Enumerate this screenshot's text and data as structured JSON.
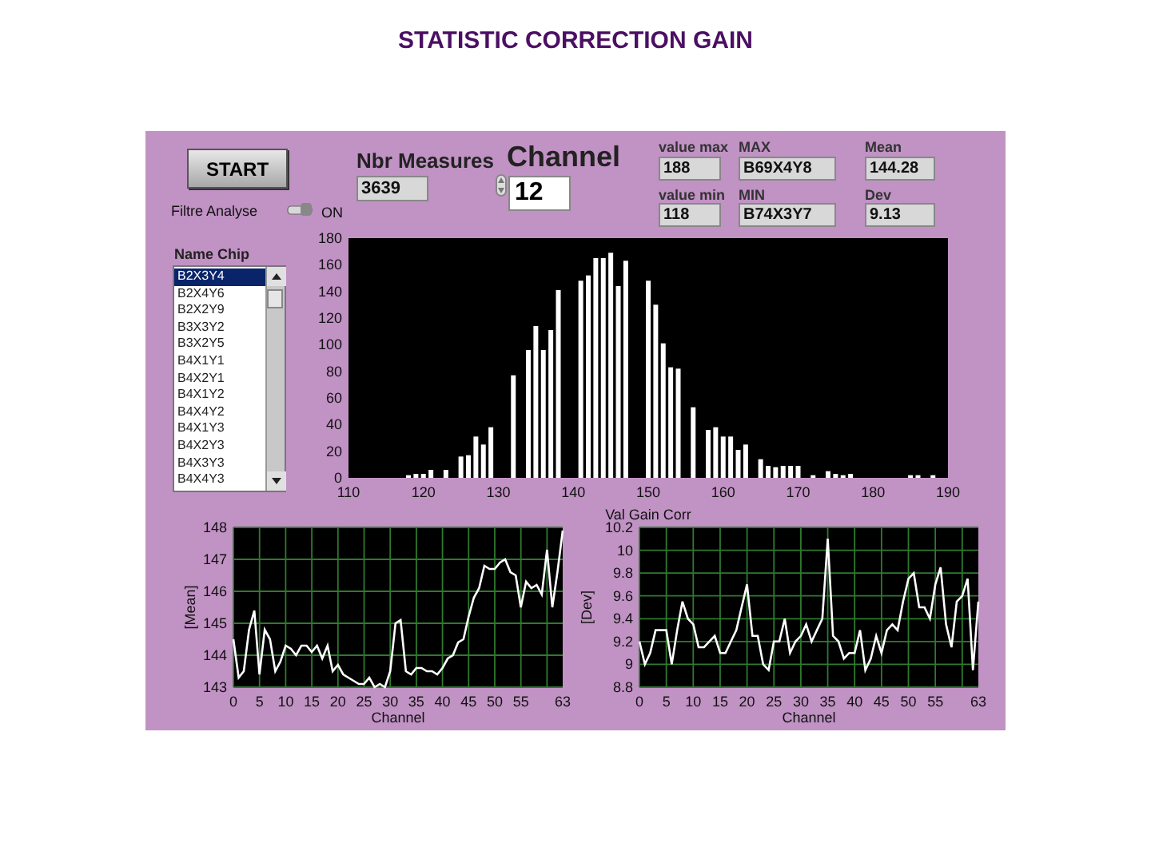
{
  "title": "STATISTIC CORRECTION GAIN",
  "start_button": {
    "label": "START"
  },
  "filter": {
    "label": "Filtre Analyse",
    "on": true,
    "state_label": "ON"
  },
  "nbr_measures": {
    "label": "Nbr Measures",
    "value": "3639"
  },
  "channel": {
    "label": "Channel",
    "value": "12"
  },
  "stats": [
    {
      "label": "value max",
      "value": "188"
    },
    {
      "label": "MAX",
      "value": "B69X4Y8"
    },
    {
      "label": "Mean",
      "value": "144.28"
    },
    {
      "label": "value min",
      "value": "118"
    },
    {
      "label": "MIN",
      "value": "B74X3Y7"
    },
    {
      "label": "Dev",
      "value": "9.13"
    }
  ],
  "name_chip": {
    "label": "Name Chip",
    "items": [
      {
        "text": "B2X3Y4",
        "selected": true
      },
      {
        "text": "B2X4Y6",
        "selected": false
      },
      {
        "text": "B2X2Y9",
        "selected": false
      },
      {
        "text": "B3X3Y2",
        "selected": false
      },
      {
        "text": "B3X2Y5",
        "selected": false
      },
      {
        "text": "B4X1Y1",
        "selected": false
      },
      {
        "text": "B4X2Y1",
        "selected": false
      },
      {
        "text": "B4X1Y2",
        "selected": false
      },
      {
        "text": "B4X4Y2",
        "selected": false
      },
      {
        "text": "B4X1Y3",
        "selected": false
      },
      {
        "text": "B4X2Y3",
        "selected": false
      },
      {
        "text": "B4X3Y3",
        "selected": false
      },
      {
        "text": "B4X4Y3",
        "selected": false
      }
    ]
  },
  "histogram": {
    "chart_data": {
      "type": "bar",
      "xlabel": "Val Gain Corr",
      "x": [
        118,
        119,
        120,
        121,
        123,
        125,
        126,
        127,
        128,
        129,
        132,
        134,
        135,
        136,
        137,
        138,
        141,
        142,
        143,
        144,
        145,
        146,
        147,
        150,
        151,
        152,
        153,
        154,
        156,
        158,
        159,
        160,
        161,
        162,
        163,
        165,
        166,
        167,
        168,
        169,
        170,
        172,
        174,
        175,
        176,
        177,
        185,
        186,
        188
      ],
      "values": [
        2,
        3,
        3,
        6,
        6,
        16,
        17,
        31,
        25,
        38,
        77,
        96,
        114,
        96,
        111,
        141,
        148,
        152,
        165,
        165,
        169,
        144,
        163,
        148,
        130,
        101,
        83,
        82,
        53,
        36,
        38,
        31,
        31,
        21,
        25,
        14,
        9,
        8,
        9,
        9,
        9,
        2,
        5,
        3,
        2,
        3,
        2,
        2,
        2
      ],
      "xlim": [
        110,
        190
      ],
      "ylim": [
        0,
        180
      ],
      "xticks": [
        110,
        120,
        130,
        140,
        150,
        160,
        170,
        180,
        190
      ],
      "yticks": [
        0,
        20,
        40,
        60,
        80,
        100,
        120,
        140,
        160,
        180
      ]
    }
  },
  "mean_chart": {
    "chart_data": {
      "type": "line",
      "xlabel": "Channel",
      "ylabel": "[Mean]",
      "x": [
        0,
        1,
        2,
        3,
        4,
        5,
        6,
        7,
        8,
        9,
        10,
        11,
        12,
        13,
        14,
        15,
        16,
        17,
        18,
        19,
        20,
        21,
        22,
        23,
        24,
        25,
        26,
        27,
        28,
        29,
        30,
        31,
        32,
        33,
        34,
        35,
        36,
        37,
        38,
        39,
        40,
        41,
        42,
        43,
        44,
        45,
        46,
        47,
        48,
        49,
        50,
        51,
        52,
        53,
        54,
        55,
        56,
        57,
        58,
        59,
        60,
        61,
        62,
        63
      ],
      "grid": true,
      "values": [
        144.5,
        143.3,
        143.5,
        144.8,
        145.4,
        143.4,
        144.8,
        144.5,
        143.5,
        143.8,
        144.3,
        144.2,
        144.0,
        144.3,
        144.3,
        144.1,
        144.3,
        143.9,
        144.3,
        143.5,
        143.7,
        143.4,
        143.3,
        143.2,
        143.1,
        143.1,
        143.3,
        143.0,
        143.1,
        143.0,
        143.5,
        145.0,
        145.1,
        143.5,
        143.4,
        143.6,
        143.6,
        143.5,
        143.5,
        143.4,
        143.6,
        143.9,
        144.0,
        144.4,
        144.5,
        145.2,
        145.8,
        146.1,
        146.8,
        146.7,
        146.7,
        146.9,
        147.0,
        146.6,
        146.5,
        145.5,
        146.3,
        146.1,
        146.2,
        145.9,
        147.3,
        145.5,
        146.6,
        147.9
      ],
      "xlim": [
        0,
        63
      ],
      "ylim": [
        143,
        148
      ],
      "xticks": [
        0,
        5,
        10,
        15,
        20,
        25,
        30,
        35,
        40,
        45,
        50,
        55,
        63
      ],
      "yticks": [
        143,
        144,
        145,
        146,
        147,
        148
      ]
    }
  },
  "dev_chart": {
    "chart_data": {
      "type": "line",
      "xlabel": "Channel",
      "ylabel": "[Dev]",
      "x": [
        0,
        1,
        2,
        3,
        4,
        5,
        6,
        7,
        8,
        9,
        10,
        11,
        12,
        13,
        14,
        15,
        16,
        17,
        18,
        19,
        20,
        21,
        22,
        23,
        24,
        25,
        26,
        27,
        28,
        29,
        30,
        31,
        32,
        33,
        34,
        35,
        36,
        37,
        38,
        39,
        40,
        41,
        42,
        43,
        44,
        45,
        46,
        47,
        48,
        49,
        50,
        51,
        52,
        53,
        54,
        55,
        56,
        57,
        58,
        59,
        60,
        61,
        62,
        63
      ],
      "grid": true,
      "values": [
        9.2,
        9.0,
        9.1,
        9.3,
        9.3,
        9.3,
        9.0,
        9.3,
        9.55,
        9.4,
        9.35,
        9.15,
        9.15,
        9.2,
        9.25,
        9.1,
        9.1,
        9.2,
        9.3,
        9.5,
        9.7,
        9.25,
        9.25,
        9.0,
        8.95,
        9.2,
        9.2,
        9.4,
        9.1,
        9.2,
        9.25,
        9.35,
        9.2,
        9.3,
        9.4,
        10.1,
        9.25,
        9.2,
        9.05,
        9.1,
        9.1,
        9.3,
        8.95,
        9.05,
        9.25,
        9.1,
        9.3,
        9.35,
        9.3,
        9.55,
        9.75,
        9.8,
        9.5,
        9.5,
        9.4,
        9.7,
        9.85,
        9.35,
        9.15,
        9.55,
        9.6,
        9.75,
        8.95,
        9.55
      ],
      "xlim": [
        0,
        63
      ],
      "ylim": [
        8.8,
        10.2
      ],
      "xticks": [
        0,
        5,
        10,
        15,
        20,
        25,
        30,
        35,
        40,
        45,
        50,
        55,
        63
      ],
      "yticks": [
        8.8,
        9,
        9.2,
        9.4,
        9.6,
        9.8,
        10,
        10.2
      ]
    }
  }
}
